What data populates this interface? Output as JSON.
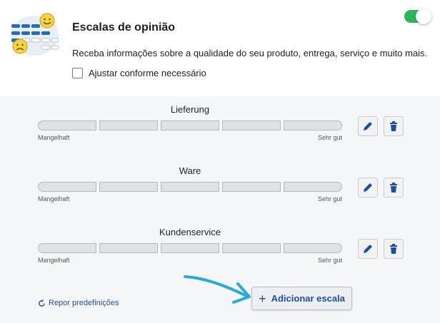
{
  "header": {
    "title": "Escalas de opinião",
    "description": "Receba informações sobre a qualidade do seu produto, entrega, serviço e muito mais.",
    "checkbox_label": "Ajustar conforme necessário",
    "toggle_on": true
  },
  "scales": [
    {
      "name": "Lieferung",
      "min_label": "Mangelhaft",
      "max_label": "Sehr gut"
    },
    {
      "name": "Ware",
      "min_label": "Mangelhaft",
      "max_label": "Sehr gut"
    },
    {
      "name": "Kundenservice",
      "min_label": "Mangelhaft",
      "max_label": "Sehr gut"
    }
  ],
  "footer": {
    "reset_label": "Repor predefinições",
    "add_label": "Adicionar escala"
  },
  "icons": {
    "edit": "pencil-icon",
    "delete": "trash-icon",
    "reset": "refresh-icon",
    "add": "plus-icon"
  },
  "colors": {
    "accent": "#1f4e9a",
    "toggle": "#2fb457",
    "annotation_arrow": "#29abd6"
  }
}
